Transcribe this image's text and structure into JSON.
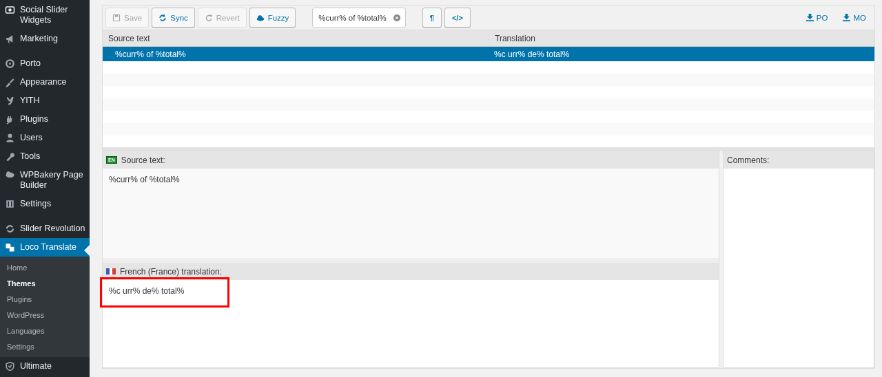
{
  "sidebar": {
    "items": [
      {
        "kind": "menu",
        "label": "Social Slider Widgets",
        "selected": false
      },
      {
        "kind": "menu",
        "label": "Marketing",
        "selected": false
      },
      {
        "kind": "separator"
      },
      {
        "kind": "menu",
        "label": "Porto",
        "selected": false
      },
      {
        "kind": "menu",
        "label": "Appearance",
        "selected": false
      },
      {
        "kind": "menu",
        "label": "YITH",
        "selected": false
      },
      {
        "kind": "menu",
        "label": "Plugins",
        "selected": false
      },
      {
        "kind": "menu",
        "label": "Users",
        "selected": false
      },
      {
        "kind": "menu",
        "label": "Tools",
        "selected": false
      },
      {
        "kind": "menu",
        "label": "WPBakery Page Builder",
        "selected": false
      },
      {
        "kind": "menu",
        "label": "Settings",
        "selected": false
      },
      {
        "kind": "separator"
      },
      {
        "kind": "menu",
        "label": "Slider Revolution",
        "selected": false
      },
      {
        "kind": "menu",
        "label": "Loco Translate",
        "selected": true,
        "children": [
          {
            "label": "Home",
            "selected": false
          },
          {
            "label": "Themes",
            "selected": true
          },
          {
            "label": "Plugins",
            "selected": false
          },
          {
            "label": "WordPress",
            "selected": false
          },
          {
            "label": "Languages",
            "selected": false
          },
          {
            "label": "Settings",
            "selected": false
          }
        ]
      },
      {
        "kind": "menu",
        "label": "Ultimate",
        "selected": false
      }
    ]
  },
  "toolbar": {
    "buttons": [
      {
        "label": "Save",
        "disabled": true
      },
      {
        "label": "Sync",
        "disabled": false
      },
      {
        "label": "Revert",
        "disabled": true
      },
      {
        "label": "Fuzzy",
        "disabled": false
      }
    ],
    "search": {
      "value": "%curr% of %total%"
    },
    "toggles": [
      "¶",
      "</>"
    ],
    "downloads": [
      "PO",
      "MO"
    ]
  },
  "table": {
    "columns": [
      "Source text",
      "Translation"
    ],
    "rows": [
      {
        "source": "%curr% of %total%",
        "translation": "%c urr% de% total%",
        "selected": true
      }
    ]
  },
  "source_pane": {
    "badge": "EN",
    "title": "Source text:",
    "text": "%curr% of %total%"
  },
  "translation_pane": {
    "title": "French (France) translation:",
    "value": "%c urr% de% total%",
    "highlighted": true
  },
  "comments_pane": {
    "title": "Comments:"
  }
}
